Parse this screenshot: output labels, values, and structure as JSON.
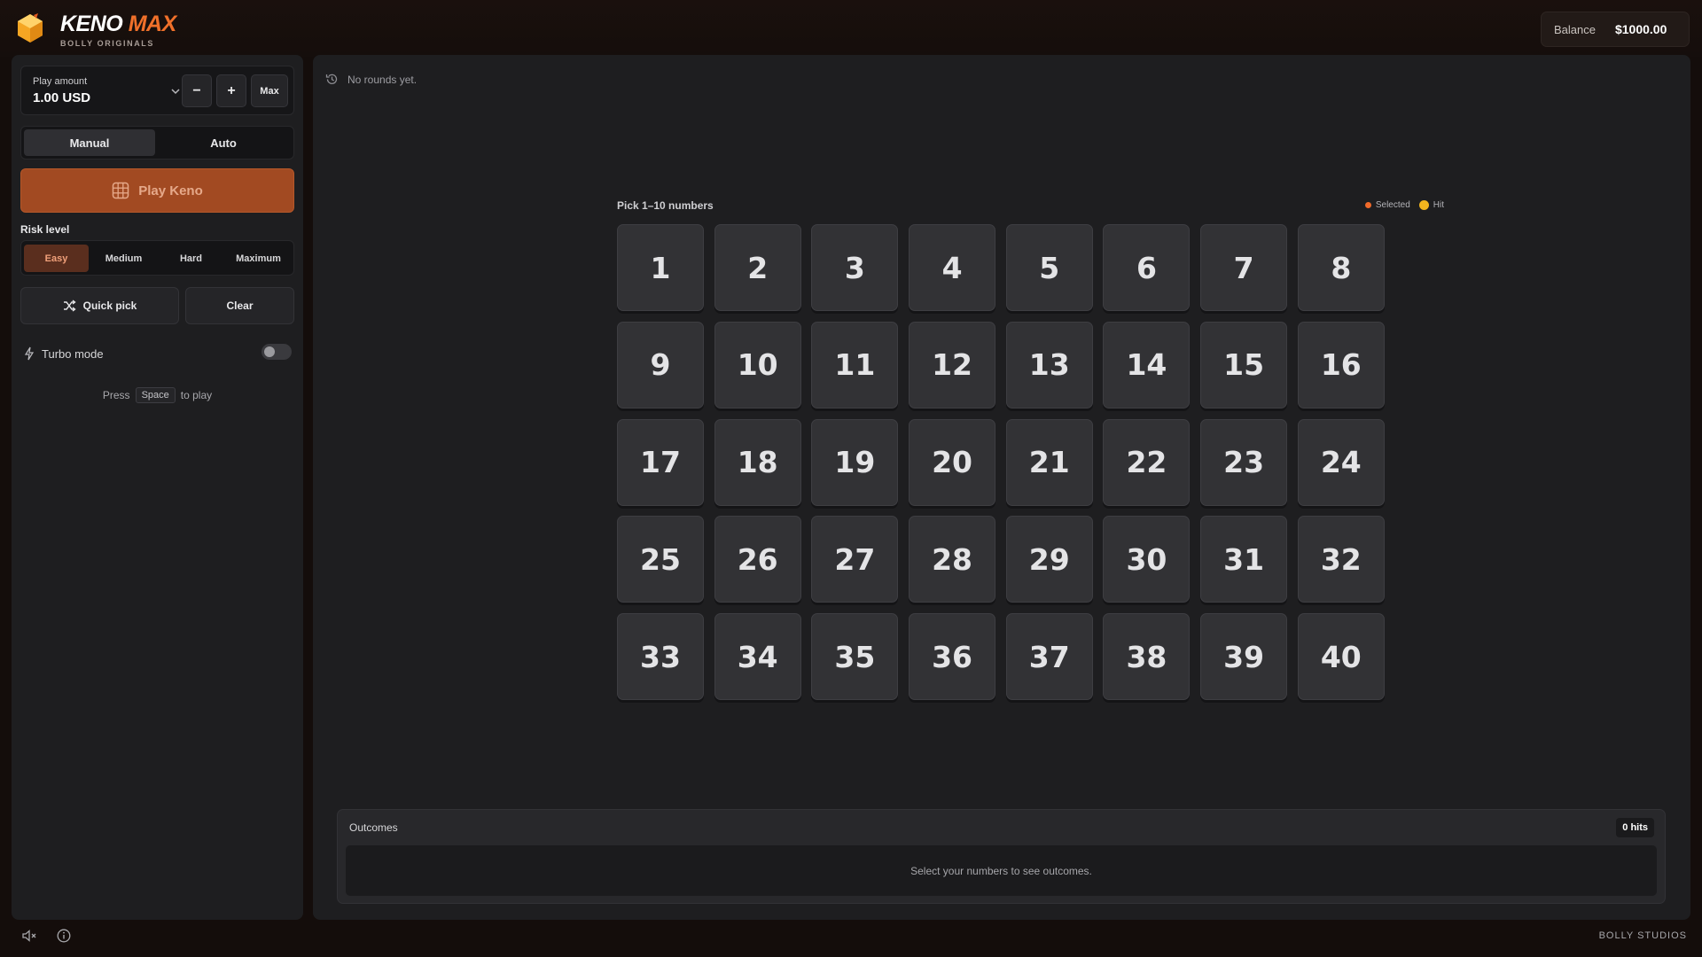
{
  "header": {
    "logo_word1": "KENO",
    "logo_word2": "MAX",
    "logo_sub": "BOLLY ORIGINALS",
    "balance_label": "Balance",
    "balance_value": "$1000.00"
  },
  "sidebar": {
    "play_amount_label": "Play amount",
    "play_amount_value": "1.00 USD",
    "minus_label": "−",
    "plus_label": "+",
    "max_label": "Max",
    "tabs": [
      "Manual",
      "Auto"
    ],
    "active_tab": "Manual",
    "play_button": "Play Keno",
    "risk_label": "Risk level",
    "risk_options": [
      "Easy",
      "Medium",
      "Hard",
      "Maximum"
    ],
    "risk_selected": "Easy",
    "quick_pick": "Quick pick",
    "clear": "Clear",
    "turbo_label": "Turbo mode",
    "turbo_on": false,
    "hint_press": "Press",
    "hint_key": "Space",
    "hint_suffix": "to play"
  },
  "main": {
    "history_text": "No rounds yet.",
    "pick_label": "Pick 1–10 numbers",
    "legend_selected": "Selected",
    "legend_hit": "Hit",
    "numbers": [
      "1",
      "2",
      "3",
      "4",
      "5",
      "6",
      "7",
      "8",
      "9",
      "10",
      "11",
      "12",
      "13",
      "14",
      "15",
      "16",
      "17",
      "18",
      "19",
      "20",
      "21",
      "22",
      "23",
      "24",
      "25",
      "26",
      "27",
      "28",
      "29",
      "30",
      "31",
      "32",
      "33",
      "34",
      "35",
      "36",
      "37",
      "38",
      "39",
      "40"
    ],
    "outcomes_title": "Outcomes",
    "hits_badge": "0 hits",
    "outcomes_empty": "Select your numbers to see outcomes."
  },
  "footer": {
    "brand": "BOLLY STUDIOS"
  },
  "colors": {
    "accent": "#f0702a",
    "play_button": "#a24a22",
    "hit": "#f2b51e",
    "selected": "#f06a2a"
  },
  "icons": [
    "logo-gem-icon",
    "chevron-down-icon",
    "grid-icon",
    "shuffle-icon",
    "lightning-icon",
    "history-icon",
    "mute-icon",
    "info-icon"
  ]
}
